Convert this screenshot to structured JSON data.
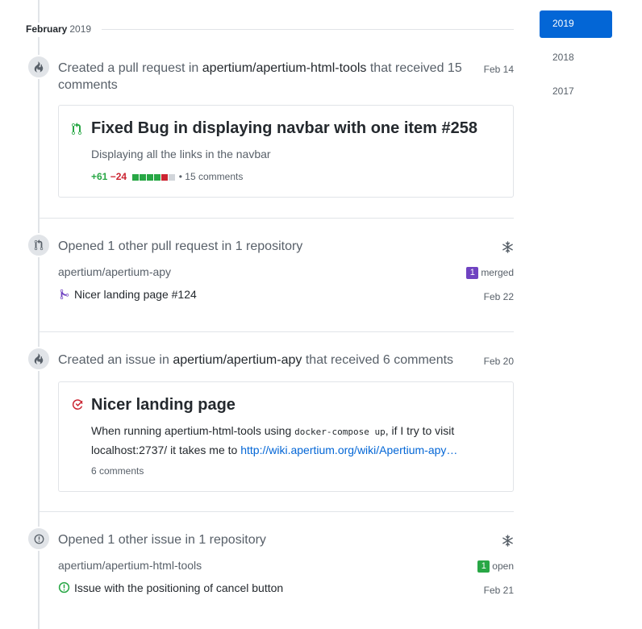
{
  "month": {
    "name": "February",
    "year": "2019"
  },
  "years": [
    "2019",
    "2018",
    "2017"
  ],
  "activities": [
    {
      "summary_prefix": "Created a pull request in",
      "repo": "apertium/apertium-html-tools",
      "summary_suffix": "that received 15 comments",
      "date": "Feb 14",
      "card": {
        "title": "Fixed Bug in displaying navbar with one item #258",
        "description": "Displaying all the links in the navbar",
        "additions": "+61",
        "deletions": "−24",
        "comments": "15 comments",
        "diffstat_colors": [
          "#28a745",
          "#28a745",
          "#28a745",
          "#28a745",
          "#cb2431",
          "#d1d5da"
        ]
      }
    },
    {
      "summary": "Opened 1 other pull request in 1 repository",
      "repo": "apertium/apertium-apy",
      "status_count": "1",
      "status_label": "merged",
      "status_color": "#6f42c1",
      "item": "Nicer landing page #124",
      "item_date": "Feb 22"
    },
    {
      "summary_prefix": "Created an issue in",
      "repo": "apertium/apertium-apy",
      "summary_suffix": "that received 6 comments",
      "date": "Feb 20",
      "card": {
        "title": "Nicer landing page",
        "desc_part1": "When running apertium-html-tools using",
        "desc_code": "docker-compose up",
        "desc_part2": ", if I try to visit",
        "desc_line2": "localhost:2737/ it takes me to",
        "desc_link": "http://wiki.apertium.org/wiki/Apertium-apy…",
        "comments": "6 comments"
      }
    },
    {
      "summary": "Opened 1 other issue in 1 repository",
      "repo": "apertium/apertium-html-tools",
      "status_count": "1",
      "status_label": "open",
      "status_color": "#28a745",
      "item": "Issue with the positioning of cancel button",
      "item_date": "Feb 21"
    }
  ],
  "colors": {
    "accent": "#0366d6",
    "pr_open": "#28a745",
    "pr_merged": "#6f42c1",
    "issue_closed": "#cb2431",
    "issue_open": "#28a745"
  }
}
